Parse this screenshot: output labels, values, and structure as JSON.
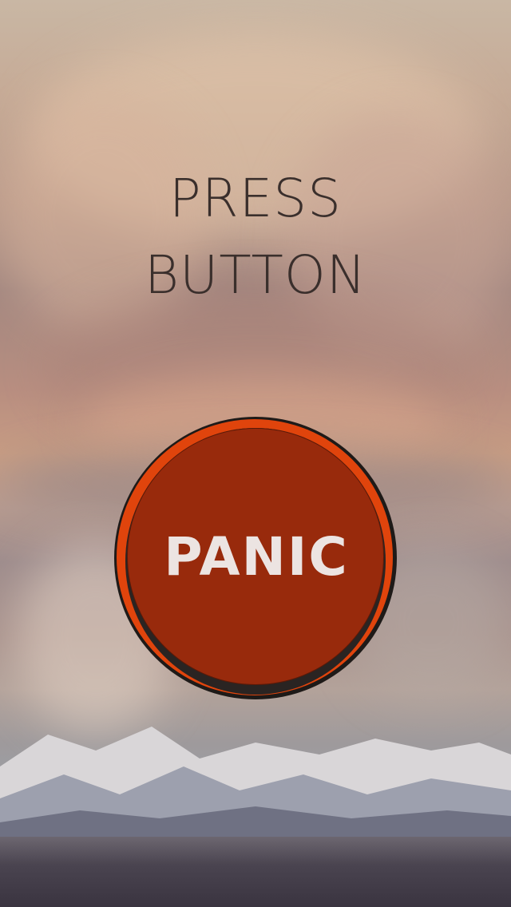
{
  "headline": {
    "line1": "PRESS",
    "line2": "BUTTON"
  },
  "panic_button": {
    "label": "PANIC",
    "face_color": "#982a0c",
    "ring_color": "#e0440c",
    "label_color": "#ece4e2"
  },
  "colors": {
    "headline_text": "#3a2f2c"
  }
}
